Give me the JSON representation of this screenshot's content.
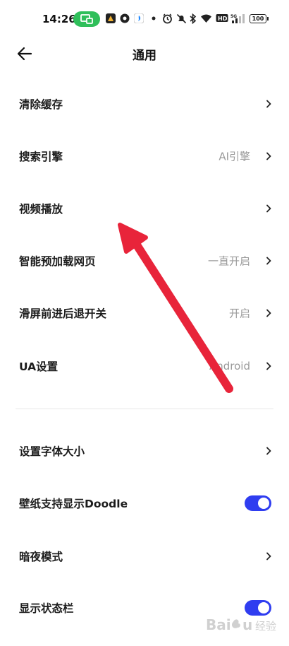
{
  "status_bar": {
    "time": "14:26",
    "battery": "100",
    "pill_color": "#2fbf5a",
    "icons": [
      "screen-cast-icon",
      "app-icon",
      "app-icon",
      "app-icon",
      "alarm-icon",
      "mute-icon",
      "bluetooth-icon",
      "wifi-icon",
      "hd-icon",
      "signal-icon",
      "battery-icon"
    ]
  },
  "header": {
    "title": "通用",
    "back_icon": "arrow-left-icon"
  },
  "settings": [
    {
      "label": "清除缓存",
      "value": "",
      "control": "chevron"
    },
    {
      "label": "搜索引擎",
      "value": "AI引擎",
      "control": "chevron"
    },
    {
      "label": "视频播放",
      "value": "",
      "control": "chevron"
    },
    {
      "label": "智能预加载网页",
      "value": "一直开启",
      "control": "chevron"
    },
    {
      "label": "滑屏前进后退开关",
      "value": "开启",
      "control": "chevron"
    },
    {
      "label": "UA设置",
      "value": "Android",
      "control": "chevron"
    },
    {
      "label": "设置字体大小",
      "value": "",
      "control": "chevron"
    },
    {
      "label": "壁纸支持显示Doodle",
      "value": "",
      "control": "toggle",
      "on": true
    },
    {
      "label": "暗夜模式",
      "value": "",
      "control": "chevron"
    },
    {
      "label": "显示状态栏",
      "value": "",
      "control": "toggle",
      "on": true
    }
  ],
  "colors": {
    "toggle_on": "#2f3df0",
    "arrow_annotation": "#e8243a",
    "value_text": "#9a9a9a"
  },
  "watermark": "Baidu 经验"
}
